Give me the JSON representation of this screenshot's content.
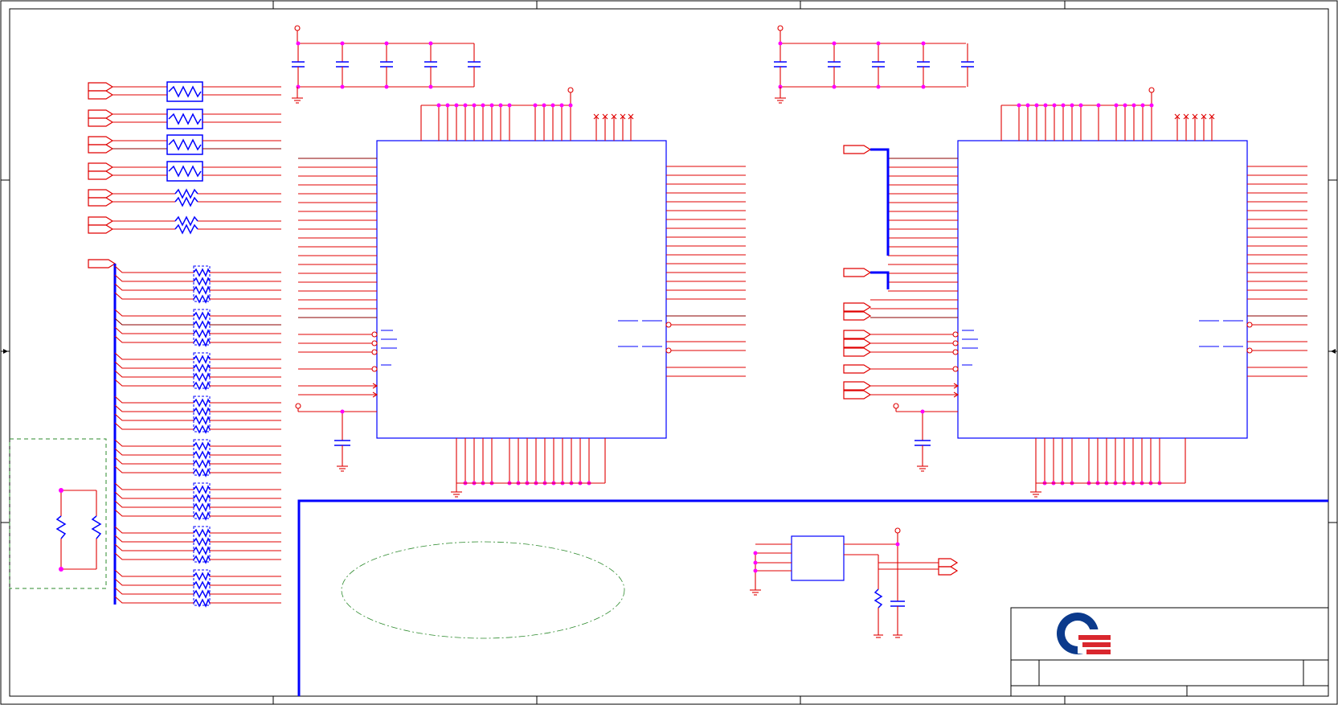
{
  "document": {
    "kind": "schematic-sheet",
    "logo": "quanta-logo",
    "title_block_text": ""
  },
  "colors": {
    "wire": "#e00000",
    "wire_dark": "#8b0000",
    "component": "#0000ff",
    "junction": "#ff00ff",
    "region_outline": "#2e8b2e",
    "logo_blue": "#0b3a8c",
    "logo_red": "#d9272e"
  }
}
